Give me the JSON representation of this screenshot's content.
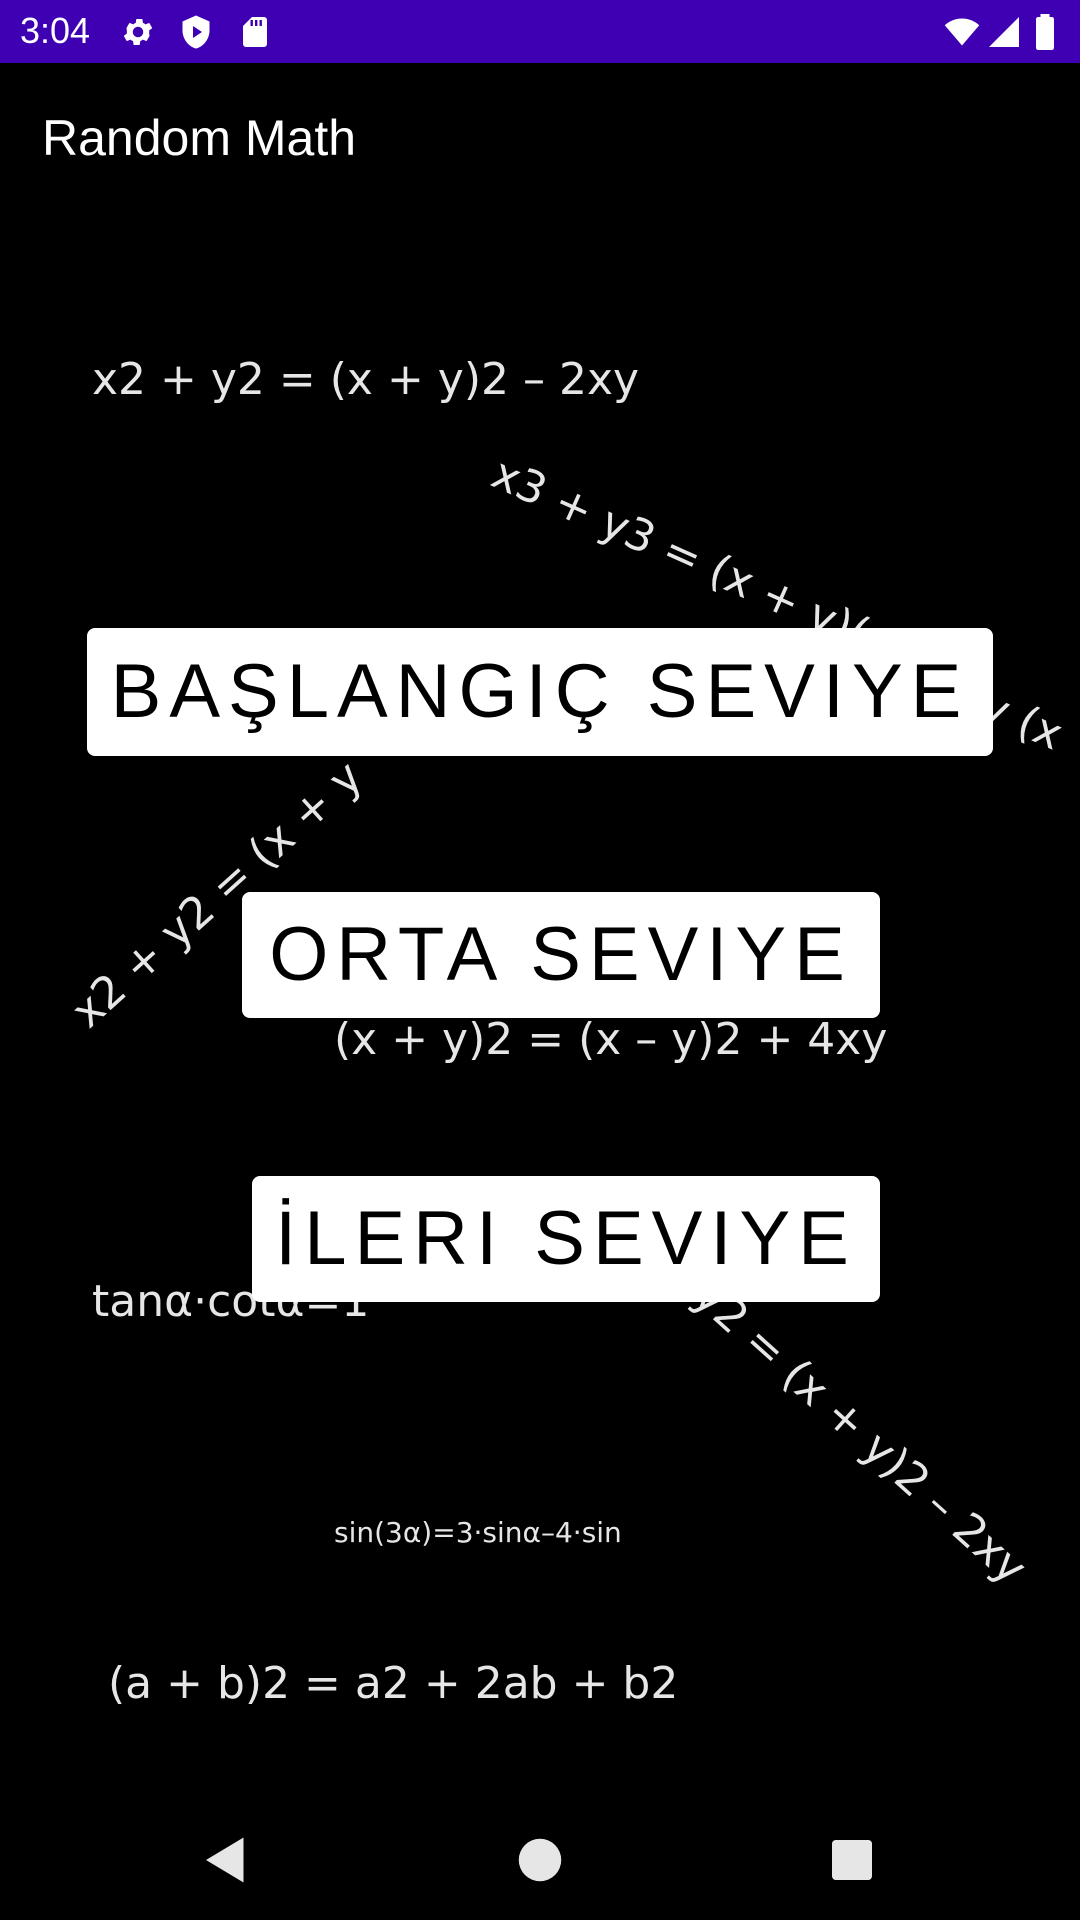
{
  "status_bar": {
    "time": "3:04",
    "icons_left": [
      "settings-icon",
      "play-protect-icon",
      "sd-card-icon"
    ],
    "icons_right": [
      "wifi-icon",
      "signal-icon",
      "battery-icon"
    ],
    "background_color": "#3F00B3"
  },
  "app_bar": {
    "title": "Random Math"
  },
  "background_formulas": [
    "x2 + y2 = (x + y)2 – 2xy",
    "x3 + y3 = (x + y)(x",
    "y (x",
    "x2 + y2 = (x + y",
    "(x + y)2 = (x – y)2 + 4xy",
    "tanα·cotα=1",
    "y2 = (x + y)2 – 2xy",
    "sin(3α)=3·sinα–4·sin",
    "(a + b)2 = a2 + 2ab + b2"
  ],
  "buttons": {
    "beginner": "BAŞLANGIÇ SEVIYE",
    "intermediate": "ORTA SEVIYE",
    "advanced": "İLERI SEVIYE"
  },
  "nav_bar": {
    "back": "back-icon",
    "home": "home-icon",
    "recents": "recents-icon"
  }
}
